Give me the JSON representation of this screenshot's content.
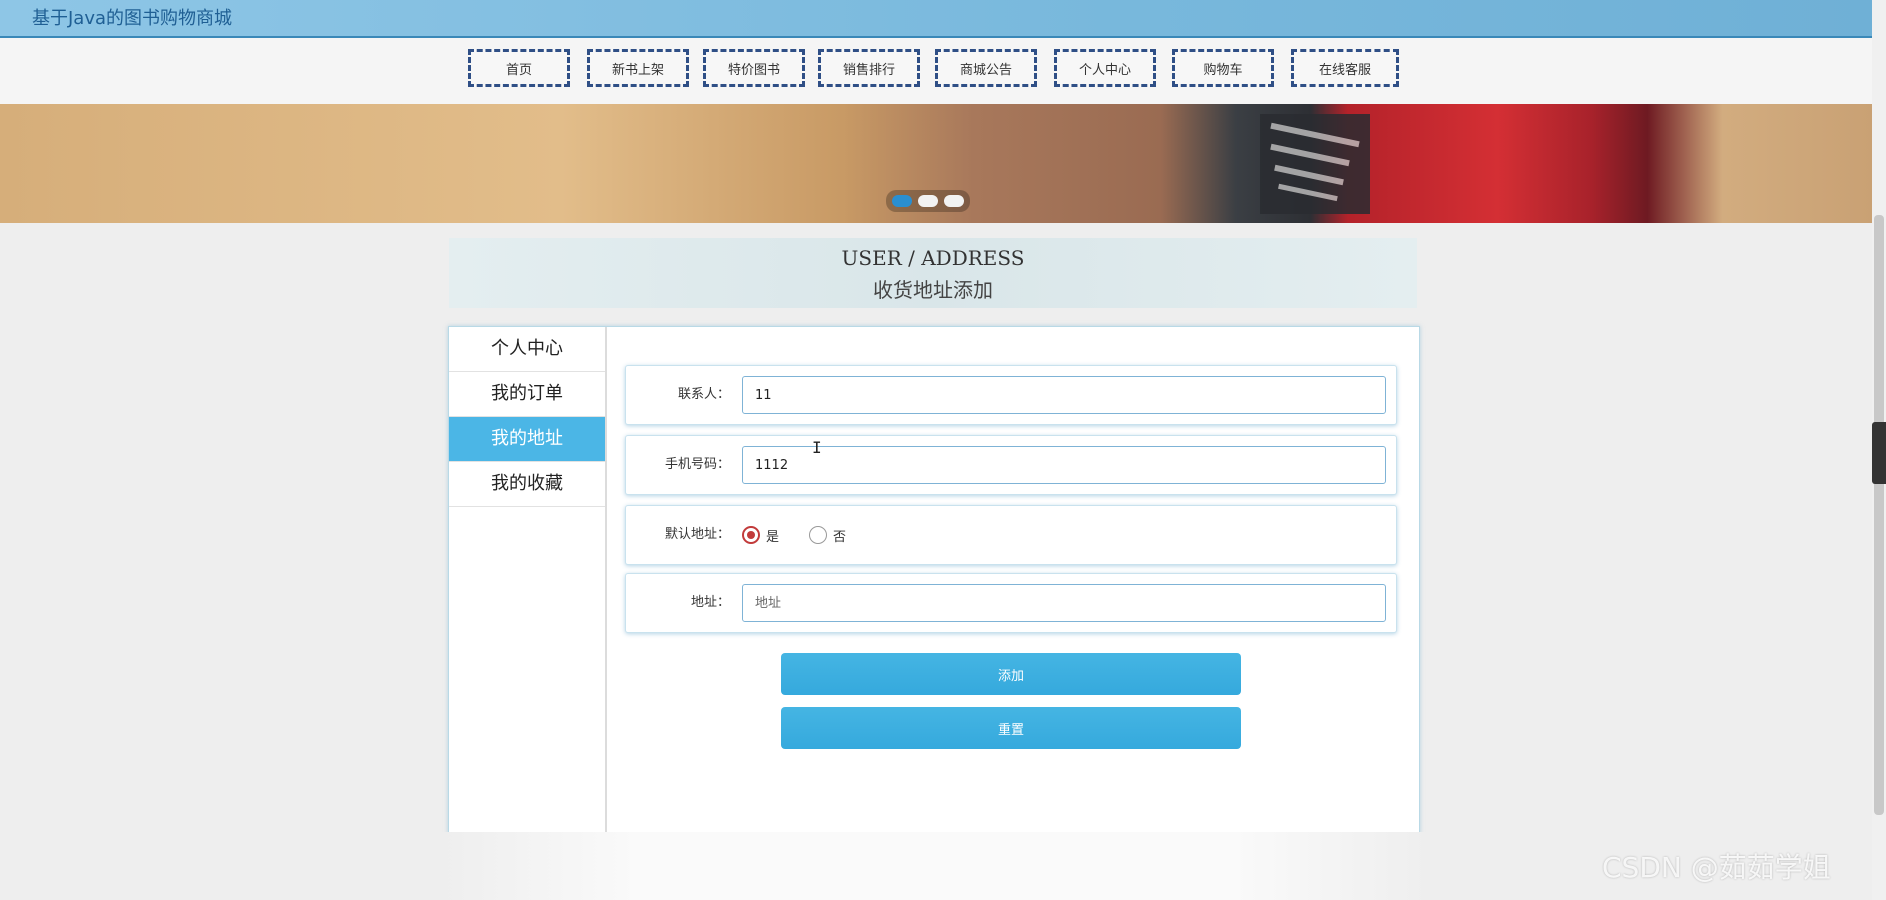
{
  "header": {
    "title": "基于Java的图书购物商城"
  },
  "nav": {
    "items": [
      {
        "label": "首页"
      },
      {
        "label": "新书上架"
      },
      {
        "label": "特价图书"
      },
      {
        "label": "销售排行"
      },
      {
        "label": "商城公告"
      },
      {
        "label": "个人中心"
      },
      {
        "label": "购物车"
      },
      {
        "label": "在线客服"
      }
    ]
  },
  "banner": {
    "slide_count": 3,
    "active_slide": 1
  },
  "section": {
    "title_en": "USER / ADDRESS",
    "title_cn": "收货地址添加"
  },
  "sidebar": {
    "items": [
      {
        "label": "个人中心"
      },
      {
        "label": "我的订单"
      },
      {
        "label": "我的地址",
        "active": true
      },
      {
        "label": "我的收藏"
      }
    ]
  },
  "form": {
    "contact": {
      "label": "联系人：",
      "value": "11",
      "placeholder": ""
    },
    "phone": {
      "label": "手机号码：",
      "value": "1112",
      "placeholder": ""
    },
    "default_address": {
      "label": "默认地址：",
      "options": [
        "是",
        "否"
      ],
      "selected": "是"
    },
    "address": {
      "label": "地址：",
      "value": "",
      "placeholder": "地址"
    },
    "add_button": "添加",
    "reset_button": "重置"
  },
  "watermark": "CSDN @茹茹学姐",
  "colors": {
    "accent": "#45b5e3",
    "nav_border": "#2f4f86",
    "radio_checked": "#c23b3b",
    "topbar": "#78b8dc"
  }
}
